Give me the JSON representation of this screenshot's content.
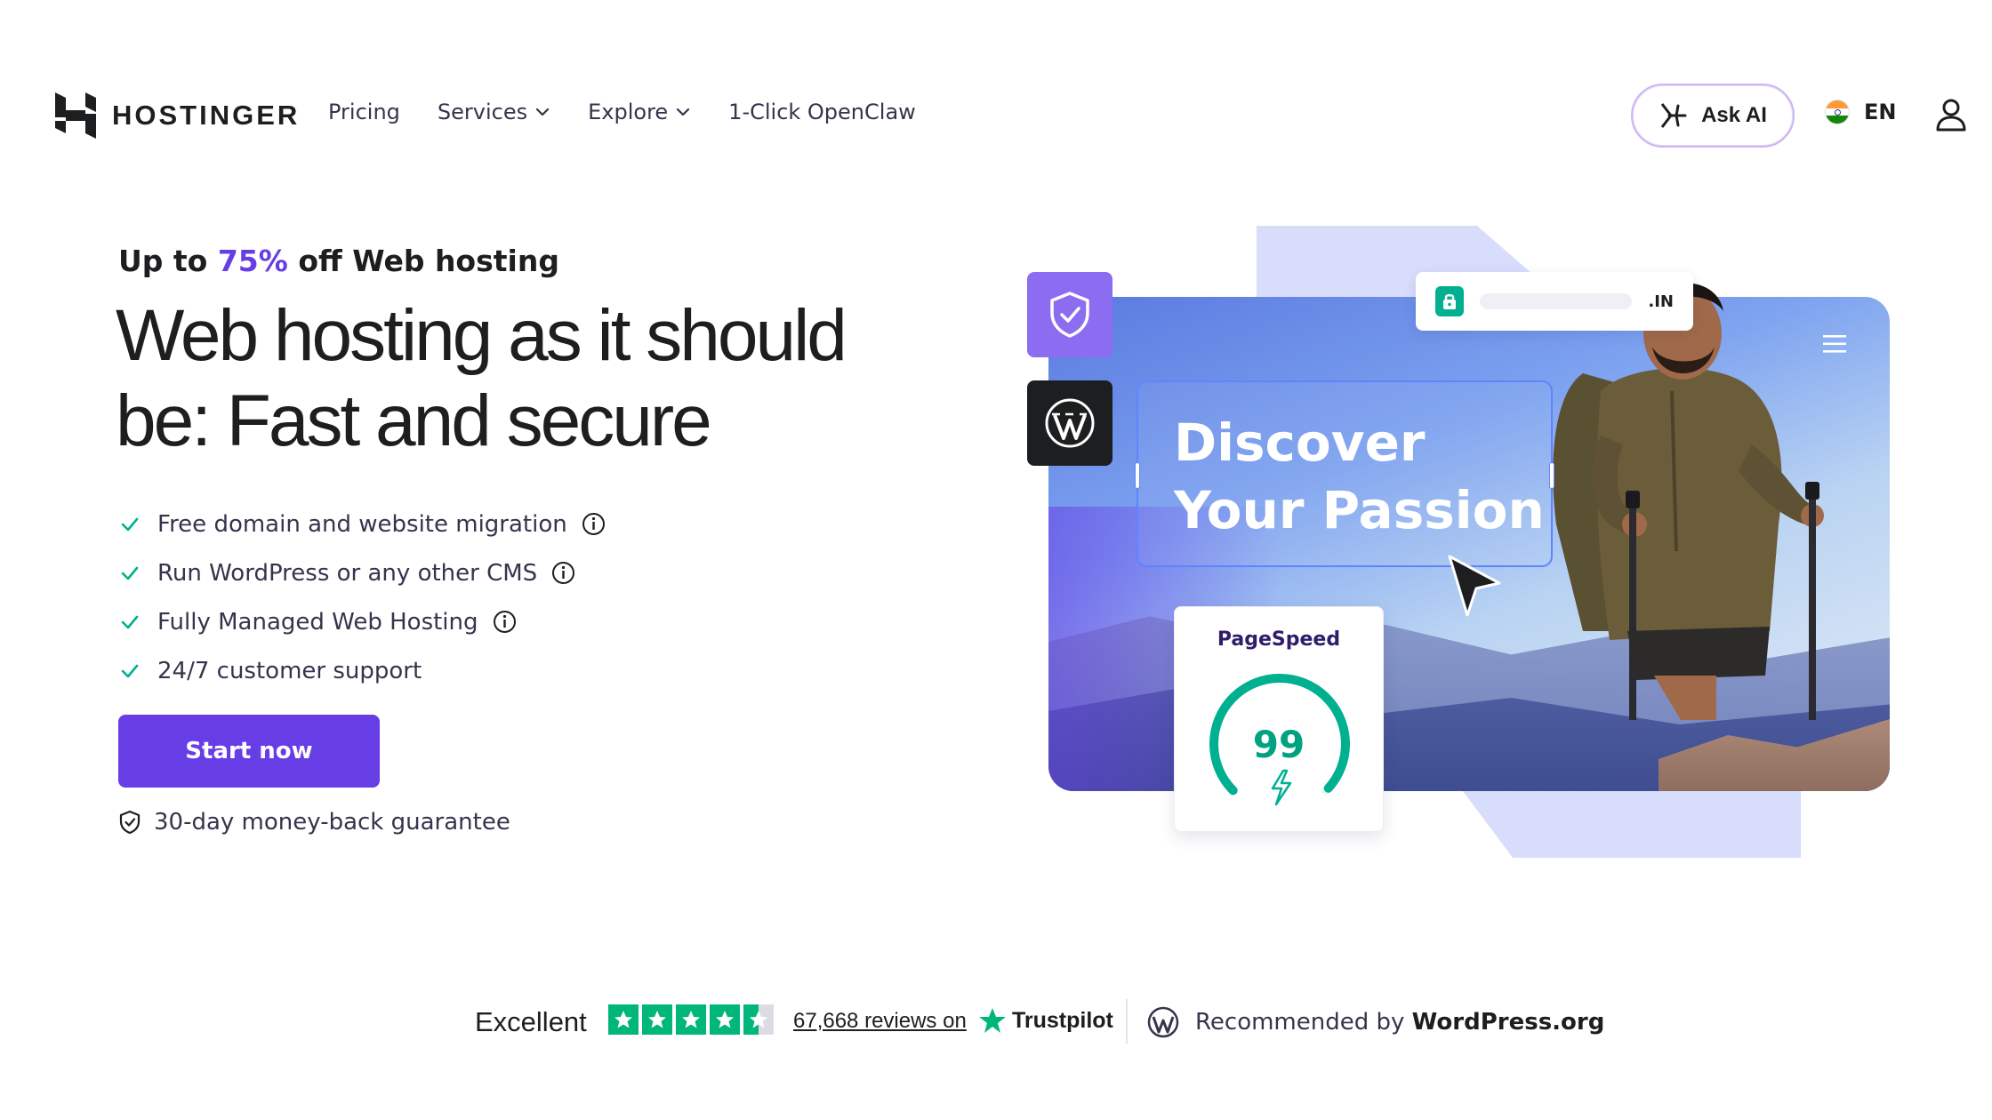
{
  "header": {
    "brand": "HOSTINGER",
    "nav": [
      {
        "label": "Pricing",
        "dropdown": false
      },
      {
        "label": "Services",
        "dropdown": true
      },
      {
        "label": "Explore",
        "dropdown": true
      },
      {
        "label": "1-Click OpenClaw",
        "dropdown": false
      }
    ],
    "ask_ai": "Ask AI",
    "language": "EN",
    "icons": {
      "ask_ai": "sparkle-icon",
      "flag": "india-flag-icon",
      "account": "user-icon"
    }
  },
  "hero": {
    "promo_prefix": "Up to ",
    "promo_highlight": "75%",
    "promo_suffix": " off Web hosting",
    "title": "Web hosting as it should be: Fast and secure",
    "features": [
      {
        "text": "Free domain and website migration",
        "info": true
      },
      {
        "text": "Run WordPress or any other CMS",
        "info": true
      },
      {
        "text": "Fully Managed Web Hosting",
        "info": true
      },
      {
        "text": "24/7 customer support",
        "info": false
      }
    ],
    "cta": "Start now",
    "guarantee": "30-day money-back guarantee"
  },
  "illustration": {
    "domain_tld": ".IN",
    "headline_line1": "Discover",
    "headline_line2": "Your Passion",
    "pagespeed_label": "PageSpeed",
    "pagespeed_score": "99",
    "pagespeed_fraction": 0.99
  },
  "trust": {
    "rating_word": "Excellent",
    "stars": 4.5,
    "reviews": "67,668 reviews on",
    "trustpilot": "Trustpilot",
    "recommended_prefix": "Recommended by ",
    "recommended_org": "WordPress.org"
  },
  "colors": {
    "brand_purple": "#673de6",
    "trustpilot_green": "#00b67a",
    "check_green": "#00b090",
    "text_dark": "#1d1e20"
  }
}
